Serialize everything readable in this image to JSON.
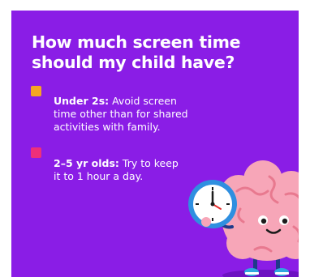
{
  "card": {
    "title_line1": "How much screen time",
    "title_line2": "should my child have?",
    "background_color": "#8a1de6",
    "items": [
      {
        "bullet_color": "#f5a623",
        "label": "Under 2s:",
        "line1": " Avoid screen",
        "line2": "time other than for shared",
        "line3": "activities with family."
      },
      {
        "bullet_color": "#ee2f7a",
        "label": "2–5 yr olds:",
        "line1": " Try to keep",
        "line2": "it to 1 hour a day."
      }
    ],
    "illustration": {
      "character": "brain-character",
      "holding": "clock-icon"
    }
  }
}
